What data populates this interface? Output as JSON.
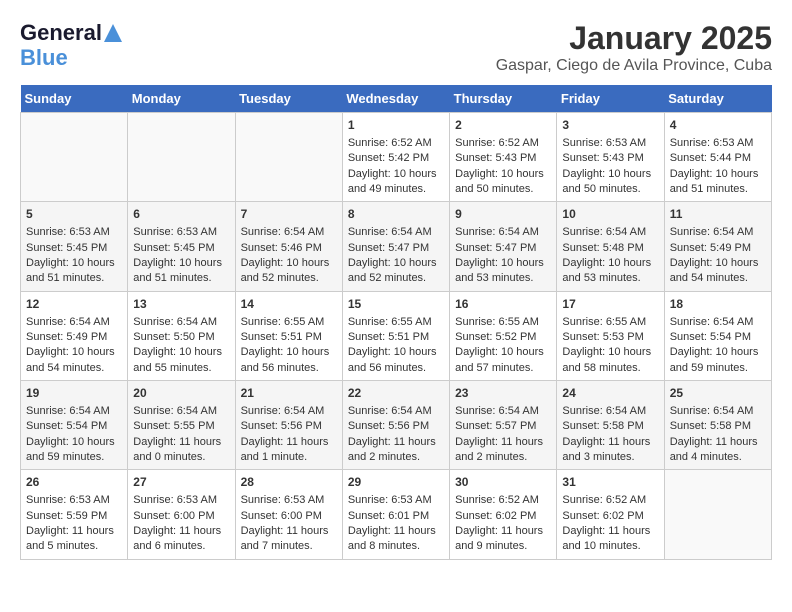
{
  "header": {
    "logo_line1": "General",
    "logo_line2": "Blue",
    "title": "January 2025",
    "subtitle": "Gaspar, Ciego de Avila Province, Cuba"
  },
  "days_of_week": [
    "Sunday",
    "Monday",
    "Tuesday",
    "Wednesday",
    "Thursday",
    "Friday",
    "Saturday"
  ],
  "weeks": [
    {
      "cells": [
        {
          "day": "",
          "content": ""
        },
        {
          "day": "",
          "content": ""
        },
        {
          "day": "",
          "content": ""
        },
        {
          "day": "1",
          "content": "Sunrise: 6:52 AM\nSunset: 5:42 PM\nDaylight: 10 hours\nand 49 minutes."
        },
        {
          "day": "2",
          "content": "Sunrise: 6:52 AM\nSunset: 5:43 PM\nDaylight: 10 hours\nand 50 minutes."
        },
        {
          "day": "3",
          "content": "Sunrise: 6:53 AM\nSunset: 5:43 PM\nDaylight: 10 hours\nand 50 minutes."
        },
        {
          "day": "4",
          "content": "Sunrise: 6:53 AM\nSunset: 5:44 PM\nDaylight: 10 hours\nand 51 minutes."
        }
      ]
    },
    {
      "cells": [
        {
          "day": "5",
          "content": "Sunrise: 6:53 AM\nSunset: 5:45 PM\nDaylight: 10 hours\nand 51 minutes."
        },
        {
          "day": "6",
          "content": "Sunrise: 6:53 AM\nSunset: 5:45 PM\nDaylight: 10 hours\nand 51 minutes."
        },
        {
          "day": "7",
          "content": "Sunrise: 6:54 AM\nSunset: 5:46 PM\nDaylight: 10 hours\nand 52 minutes."
        },
        {
          "day": "8",
          "content": "Sunrise: 6:54 AM\nSunset: 5:47 PM\nDaylight: 10 hours\nand 52 minutes."
        },
        {
          "day": "9",
          "content": "Sunrise: 6:54 AM\nSunset: 5:47 PM\nDaylight: 10 hours\nand 53 minutes."
        },
        {
          "day": "10",
          "content": "Sunrise: 6:54 AM\nSunset: 5:48 PM\nDaylight: 10 hours\nand 53 minutes."
        },
        {
          "day": "11",
          "content": "Sunrise: 6:54 AM\nSunset: 5:49 PM\nDaylight: 10 hours\nand 54 minutes."
        }
      ]
    },
    {
      "cells": [
        {
          "day": "12",
          "content": "Sunrise: 6:54 AM\nSunset: 5:49 PM\nDaylight: 10 hours\nand 54 minutes."
        },
        {
          "day": "13",
          "content": "Sunrise: 6:54 AM\nSunset: 5:50 PM\nDaylight: 10 hours\nand 55 minutes."
        },
        {
          "day": "14",
          "content": "Sunrise: 6:55 AM\nSunset: 5:51 PM\nDaylight: 10 hours\nand 56 minutes."
        },
        {
          "day": "15",
          "content": "Sunrise: 6:55 AM\nSunset: 5:51 PM\nDaylight: 10 hours\nand 56 minutes."
        },
        {
          "day": "16",
          "content": "Sunrise: 6:55 AM\nSunset: 5:52 PM\nDaylight: 10 hours\nand 57 minutes."
        },
        {
          "day": "17",
          "content": "Sunrise: 6:55 AM\nSunset: 5:53 PM\nDaylight: 10 hours\nand 58 minutes."
        },
        {
          "day": "18",
          "content": "Sunrise: 6:54 AM\nSunset: 5:54 PM\nDaylight: 10 hours\nand 59 minutes."
        }
      ]
    },
    {
      "cells": [
        {
          "day": "19",
          "content": "Sunrise: 6:54 AM\nSunset: 5:54 PM\nDaylight: 10 hours\nand 59 minutes."
        },
        {
          "day": "20",
          "content": "Sunrise: 6:54 AM\nSunset: 5:55 PM\nDaylight: 11 hours\nand 0 minutes."
        },
        {
          "day": "21",
          "content": "Sunrise: 6:54 AM\nSunset: 5:56 PM\nDaylight: 11 hours\nand 1 minute."
        },
        {
          "day": "22",
          "content": "Sunrise: 6:54 AM\nSunset: 5:56 PM\nDaylight: 11 hours\nand 2 minutes."
        },
        {
          "day": "23",
          "content": "Sunrise: 6:54 AM\nSunset: 5:57 PM\nDaylight: 11 hours\nand 2 minutes."
        },
        {
          "day": "24",
          "content": "Sunrise: 6:54 AM\nSunset: 5:58 PM\nDaylight: 11 hours\nand 3 minutes."
        },
        {
          "day": "25",
          "content": "Sunrise: 6:54 AM\nSunset: 5:58 PM\nDaylight: 11 hours\nand 4 minutes."
        }
      ]
    },
    {
      "cells": [
        {
          "day": "26",
          "content": "Sunrise: 6:53 AM\nSunset: 5:59 PM\nDaylight: 11 hours\nand 5 minutes."
        },
        {
          "day": "27",
          "content": "Sunrise: 6:53 AM\nSunset: 6:00 PM\nDaylight: 11 hours\nand 6 minutes."
        },
        {
          "day": "28",
          "content": "Sunrise: 6:53 AM\nSunset: 6:00 PM\nDaylight: 11 hours\nand 7 minutes."
        },
        {
          "day": "29",
          "content": "Sunrise: 6:53 AM\nSunset: 6:01 PM\nDaylight: 11 hours\nand 8 minutes."
        },
        {
          "day": "30",
          "content": "Sunrise: 6:52 AM\nSunset: 6:02 PM\nDaylight: 11 hours\nand 9 minutes."
        },
        {
          "day": "31",
          "content": "Sunrise: 6:52 AM\nSunset: 6:02 PM\nDaylight: 11 hours\nand 10 minutes."
        },
        {
          "day": "",
          "content": ""
        }
      ]
    }
  ]
}
